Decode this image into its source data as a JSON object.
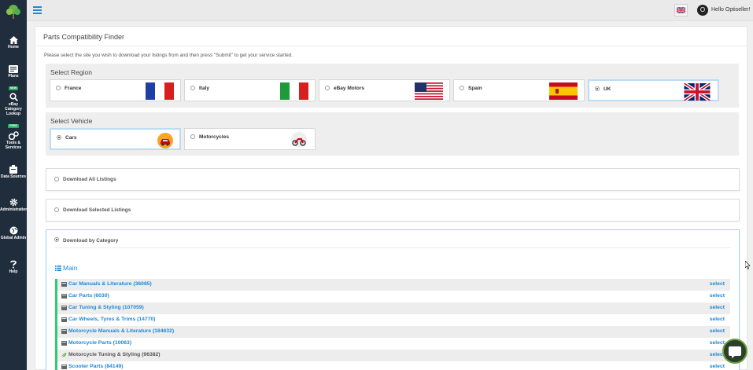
{
  "app": {
    "brand_color": "#1e88d6",
    "sidebar_color": "#1f2d3d",
    "accent_green": "#2ecc71"
  },
  "sidebar": {
    "logo": "tree-logo",
    "items": [
      {
        "label": "Home",
        "icon": "home-icon",
        "badge": ""
      },
      {
        "label": "Plans",
        "icon": "plans-icon",
        "badge": "NEW"
      },
      {
        "label": "eBay Category Lookup",
        "icon": "search-icon",
        "badge": "FREE"
      },
      {
        "label": "Tools & Services",
        "icon": "tools-icon",
        "badge": ""
      },
      {
        "label": "Data Sources",
        "icon": "database-icon",
        "badge": ""
      },
      {
        "label": "Administration",
        "icon": "gear-icon",
        "badge": ""
      },
      {
        "label": "Global Admin",
        "icon": "globe-icon",
        "badge": ""
      },
      {
        "label": "Help",
        "icon": "help-icon",
        "badge": ""
      }
    ]
  },
  "topbar": {
    "language_icon": "uk-flag-icon",
    "avatar_initial": "O",
    "greeting": "Hello Optiseller!"
  },
  "page": {
    "title": "Parts Compatibility Finder",
    "instructions": "Please select the site you wish to download your listings from and then press \"Submit\" to get your service started."
  },
  "region": {
    "title": "Select Region",
    "options": [
      {
        "label": "France",
        "flag": "france-flag",
        "selected": false
      },
      {
        "label": "Italy",
        "flag": "italy-flag",
        "selected": false
      },
      {
        "label": "eBay Motors",
        "flag": "usa-flag",
        "selected": false
      },
      {
        "label": "Spain",
        "flag": "spain-flag",
        "selected": false
      },
      {
        "label": "UK",
        "flag": "uk-flag",
        "selected": true
      }
    ]
  },
  "vehicle": {
    "title": "Select Vehicle",
    "options": [
      {
        "label": "Cars",
        "icon": "car-icon",
        "selected": true
      },
      {
        "label": "Motorcycles",
        "icon": "motorcycle-icon",
        "selected": false
      }
    ]
  },
  "download": {
    "all": {
      "label": "Download All Listings",
      "selected": false
    },
    "selected": {
      "label": "Download Selected Listings",
      "selected": false
    },
    "by_category": {
      "label": "Download by Category",
      "selected": true
    }
  },
  "categories": {
    "heading": "Main",
    "select_label": "select",
    "items": [
      {
        "name": "Car Manuals & Literature (36085)",
        "icon": "folder-icon"
      },
      {
        "name": "Car Parts (6030)",
        "icon": "folder-icon"
      },
      {
        "name": "Car Tuning & Styling (107059)",
        "icon": "folder-icon"
      },
      {
        "name": "Car Wheels, Tyres & Trims (14770)",
        "icon": "folder-icon"
      },
      {
        "name": "Motorcycle Manuals & Literature (184632)",
        "icon": "folder-icon"
      },
      {
        "name": "Motorcycle Parts (10063)",
        "icon": "folder-icon"
      },
      {
        "name": "Motorcycle Tuning & Styling (96382)",
        "icon": "leaf-icon"
      },
      {
        "name": "Scooter Parts (84149)",
        "icon": "folder-icon"
      }
    ]
  }
}
